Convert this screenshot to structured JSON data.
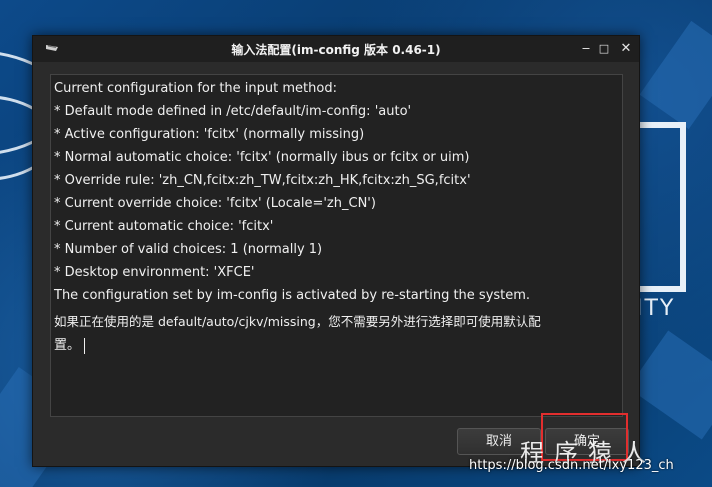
{
  "window": {
    "title": "输入法配置(im-config 版本 0.46-1)",
    "controls": [
      "‒",
      "□",
      "✕"
    ]
  },
  "content": {
    "lines": [
      "Current configuration for the input method:",
      " * Default mode defined in /etc/default/im-config: 'auto'",
      " * Active configuration: 'fcitx' (normally missing)",
      " * Normal automatic choice: 'fcitx' (normally ibus or fcitx or uim)",
      " * Override rule: 'zh_CN,fcitx:zh_TW,fcitx:zh_HK,fcitx:zh_SG,fcitx'",
      " * Current override choice: 'fcitx' (Locale='zh_CN')",
      " * Current automatic choice: 'fcitx'",
      " * Number of valid choices: 1 (normally 1)",
      " * Desktop environment: 'XFCE'",
      "The configuration set by im-config is activated by re-starting the system.",
      "如果正在使用的是 default/auto/cjkv/missing，您不需要另外进行选择即可使用默认配",
      "置。"
    ]
  },
  "buttons": {
    "cancel": "取消",
    "ok": "确定"
  },
  "wallpaper": {
    "text": "ITY"
  },
  "watermark": {
    "url": "https://blog.csdn.net/lxy123_ch",
    "signature": "程序猿人"
  },
  "colors": {
    "highlight": "#e22e2e",
    "window_bg": "#2b2b2b",
    "desktop_bg": "#0a3f78"
  }
}
